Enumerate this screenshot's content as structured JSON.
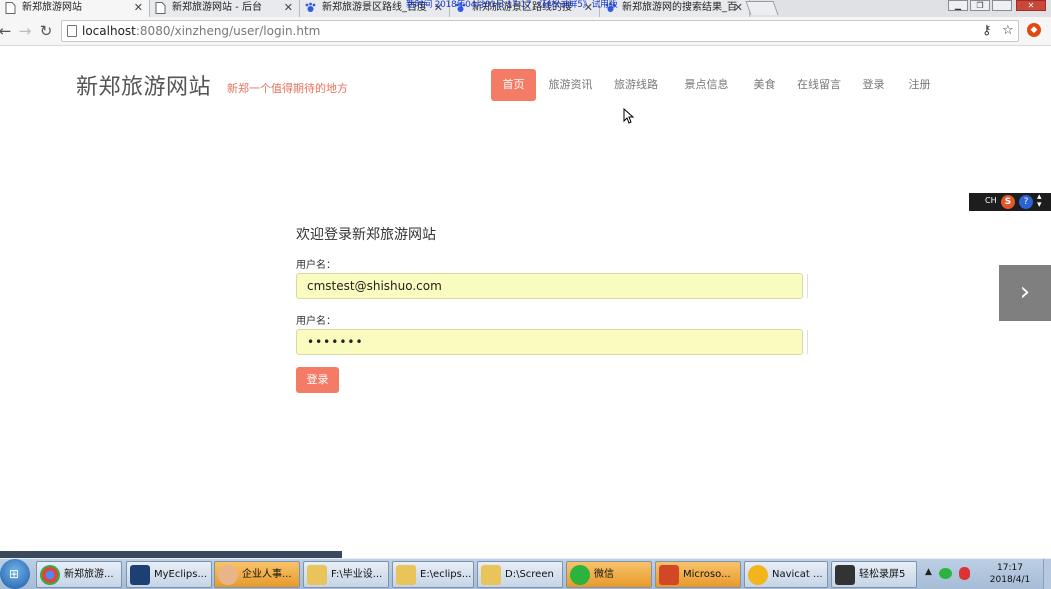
{
  "browser": {
    "tabs": [
      {
        "title": "新郑旅游网站",
        "active": true
      },
      {
        "title": "新郑旅游网站 - 后台",
        "active": false
      },
      {
        "title": "新郑旅游景区路线_百度",
        "active": false
      },
      {
        "title": "新郑旅游景区路线的搜",
        "active": false
      },
      {
        "title": "新郑旅游网的搜索结果_百",
        "active": false
      }
    ],
    "overlay_text": "新时间 2018年04月01日 17:17 《轻松录屏5》试用版",
    "url_host": "localhost",
    "url_rest": ":8080/xinzheng/user/login.htm",
    "window_controls": {
      "minimize": "▁",
      "restore": "❐",
      "close": "✕"
    }
  },
  "site": {
    "brand": "新郑旅游网站",
    "slogan": "新郑一个值得期待的地方",
    "nav": [
      {
        "label": "首页",
        "active": true
      },
      {
        "label": "旅游资讯",
        "active": false
      },
      {
        "label": "旅游线路",
        "active": false
      },
      {
        "label": "景点信息",
        "active": false
      },
      {
        "label": "美食",
        "active": false
      },
      {
        "label": "在线留言",
        "active": false
      },
      {
        "label": "登录",
        "active": false
      },
      {
        "label": "注册",
        "active": false
      }
    ]
  },
  "login": {
    "title": "欢迎登录新郑旅游网站",
    "username_label": "用户名：",
    "username_value": "cmstest@shishuo.com",
    "password_label": "用户名：",
    "password_value": "•••••••",
    "submit_label": "登录"
  },
  "side": {
    "lang_label": "CH",
    "sogou": "S",
    "help": "?",
    "next_arrow": "›"
  },
  "taskbar": {
    "items": [
      {
        "label": "新郑旅游...",
        "icon": "chrome-icon",
        "color": "#3c9a3c"
      },
      {
        "label": "MyEclips...",
        "icon": "myeclipse-icon",
        "color": "#1d3f73"
      },
      {
        "label": "企业人事...",
        "icon": "avatar-icon",
        "color": "#e8b48a",
        "orange": true
      },
      {
        "label": "F:\\毕业设...",
        "icon": "folder-icon",
        "color": "#e9c45a"
      },
      {
        "label": "E:\\eclips...",
        "icon": "folder-icon",
        "color": "#e9c45a"
      },
      {
        "label": "D:\\Screen",
        "icon": "folder-icon",
        "color": "#e9c45a"
      },
      {
        "label": "微信",
        "icon": "wechat-icon",
        "color": "#2bb33d",
        "orange": true
      },
      {
        "label": "Microso...",
        "icon": "powerpoint-icon",
        "color": "#d24726",
        "orange": true
      },
      {
        "label": "Navicat ...",
        "icon": "navicat-icon",
        "color": "#f2b51c"
      },
      {
        "label": "轻松录屏5",
        "icon": "recorder-icon",
        "color": "#333333"
      }
    ],
    "time": "17:17",
    "date": "2018/4/1"
  },
  "colors": {
    "accent": "#f47c67",
    "autofill_bg": "#fafbbe"
  }
}
